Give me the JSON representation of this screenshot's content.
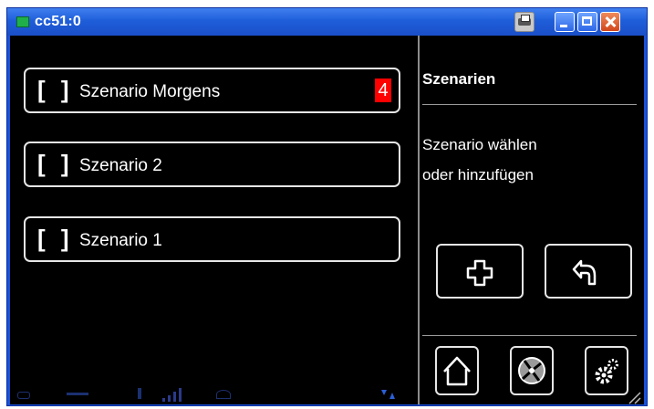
{
  "window": {
    "title": "cc51:0"
  },
  "titlebar_buttons": [
    "print-icon",
    "minimize-icon",
    "maximize-icon",
    "close-icon"
  ],
  "list": {
    "items": [
      {
        "bracket": "[ ]",
        "label": "Szenario Morgens",
        "badge": "4"
      },
      {
        "bracket": "[ ]",
        "label": "Szenario 2"
      },
      {
        "bracket": "[ ]",
        "label": "Szenario 1"
      }
    ]
  },
  "panel": {
    "title": "Szenarien",
    "description_line1": "Szenario wählen",
    "description_line2": "oder hinzufügen"
  },
  "actions": [
    "plus-icon",
    "back-icon"
  ],
  "nav": [
    "home-icon",
    "fan-icon",
    "settings-icon"
  ],
  "colors": {
    "titlebar": "#1f5ed9",
    "screen_bg": "#000000",
    "badge": "#ff0000",
    "outline": "#e6e6e6"
  }
}
